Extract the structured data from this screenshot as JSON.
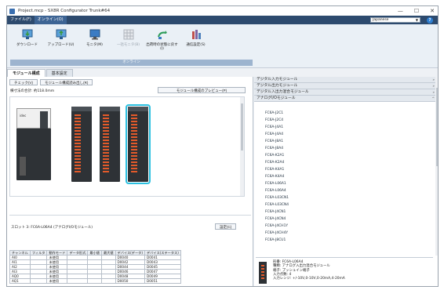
{
  "window": {
    "title": "Project.mcp - SX8R Configurator Trunk#64",
    "minimize": "—",
    "maximize": "☐",
    "close": "✕"
  },
  "menu": {
    "items": [
      {
        "label": "ファイル(F)",
        "active": false
      },
      {
        "label": "オンライン(O)",
        "active": true
      }
    ],
    "language": "Japanese",
    "help": "?"
  },
  "ribbon": {
    "buttons": [
      {
        "label": "ダウンロード",
        "icon": "download-icon",
        "enabled": true
      },
      {
        "label": "アップロード(U)",
        "icon": "upload-icon",
        "enabled": true
      },
      {
        "label": "モニタ(M)",
        "icon": "monitor-icon",
        "enabled": true
      },
      {
        "label": "一括モニタ(B)",
        "icon": "grid-icon",
        "enabled": false
      },
      {
        "label": "出荷時の状態に戻す(I)",
        "icon": "reset-icon",
        "enabled": true
      },
      {
        "label": "通信設定(S)",
        "icon": "comm-settings-icon",
        "enabled": true
      }
    ],
    "group_label": "オンライン"
  },
  "tabs": [
    {
      "label": "モジュール構成",
      "active": true
    },
    {
      "label": "基本設定",
      "active": false
    }
  ],
  "left": {
    "check_button": "チェック(V)",
    "read_config_button": "モジュール構成読み出し(R)",
    "width_total": "横寸法の合計: 約118.0mm",
    "preview_button": "モジュール構成のプレビュー(P)",
    "cpu_brand": "idec",
    "slot_info": "スロット 3: FC6A-L06A4 (アナログI/Oモジュール)",
    "setting_button": "設定(C)",
    "table": {
      "headers": [
        "チャンネル",
        "フィルタ",
        "動作モード",
        "データ形式",
        "最小値",
        "最大値",
        "デバイス(データ)",
        "デバイス(ステータス)"
      ],
      "rows": [
        [
          "AI0",
          "",
          "未使用",
          "",
          "",
          "",
          "D0040",
          "D0041"
        ],
        [
          "AI1",
          "",
          "未使用",
          "",
          "",
          "",
          "D0042",
          "D0043"
        ],
        [
          "AI2",
          "",
          "未使用",
          "",
          "",
          "",
          "D0044",
          "D0045"
        ],
        [
          "AI3",
          "",
          "未使用",
          "",
          "",
          "",
          "D0046",
          "D0047"
        ],
        [
          "AQ0",
          "",
          "未使用",
          "",
          "",
          "",
          "D0048",
          "D0049"
        ],
        [
          "AQ1",
          "",
          "未使用",
          "",
          "",
          "",
          "D0050",
          "D0051"
        ]
      ]
    }
  },
  "right": {
    "categories": [
      {
        "label": "デジタル入力モジュール",
        "chevron": "»"
      },
      {
        "label": "デジタル出力モジュール",
        "chevron": "»"
      },
      {
        "label": "デジタル入出力混合モジュール",
        "chevron": "»"
      },
      {
        "label": "アナログI/Oモジュール",
        "chevron": "^"
      }
    ],
    "modules": [
      "FC6A-J2C1",
      "FC6A-J2C4",
      "FC6A-J4A1",
      "FC6A-J4A4",
      "FC6A-J8A1",
      "FC6A-J8A4",
      "FC6A-K2A1",
      "FC6A-K2A4",
      "FC6A-K4A1",
      "FC6A-K4A4",
      "FC6A-L06A1",
      "FC6A-L06A4",
      "FC6A-L03CN1",
      "FC6A-L03CN4",
      "FC6A-J4CN1",
      "FC6A-J4CN4",
      "FC6A-J4CH1Y",
      "FC6A-J4CH4Y",
      "FC6A-J8CU1"
    ],
    "detail": {
      "model": "形番: FC6A-L06A4",
      "type": "種類: アナログ入出力混合モジュール",
      "terminal": "端子: プッシュイン端子",
      "inputs": "入力点数: 4",
      "range": "入力レンジ: +/-10V,0-10V,0-20mA,4-20mA"
    }
  },
  "colors": {
    "menubar": "#2d4a6e",
    "selection_outline": "#2cc0e0",
    "terminal": "#e35a2a"
  }
}
